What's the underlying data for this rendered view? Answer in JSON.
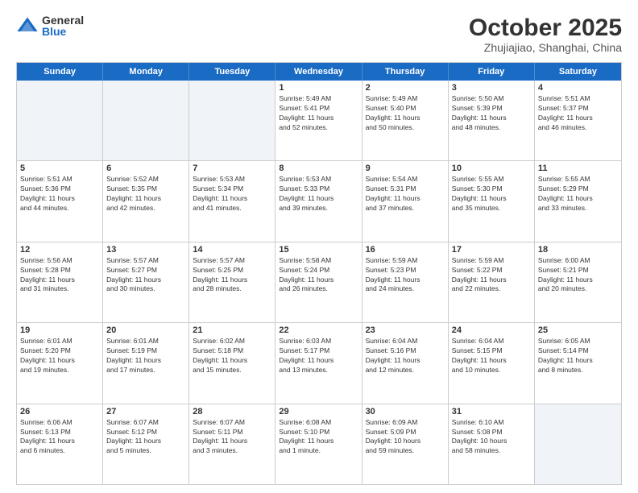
{
  "logo": {
    "general": "General",
    "blue": "Blue"
  },
  "title": "October 2025",
  "location": "Zhujiajiao, Shanghai, China",
  "weekdays": [
    "Sunday",
    "Monday",
    "Tuesday",
    "Wednesday",
    "Thursday",
    "Friday",
    "Saturday"
  ],
  "rows": [
    [
      {
        "day": "",
        "info": ""
      },
      {
        "day": "",
        "info": ""
      },
      {
        "day": "",
        "info": ""
      },
      {
        "day": "1",
        "info": "Sunrise: 5:49 AM\nSunset: 5:41 PM\nDaylight: 11 hours\nand 52 minutes."
      },
      {
        "day": "2",
        "info": "Sunrise: 5:49 AM\nSunset: 5:40 PM\nDaylight: 11 hours\nand 50 minutes."
      },
      {
        "day": "3",
        "info": "Sunrise: 5:50 AM\nSunset: 5:39 PM\nDaylight: 11 hours\nand 48 minutes."
      },
      {
        "day": "4",
        "info": "Sunrise: 5:51 AM\nSunset: 5:37 PM\nDaylight: 11 hours\nand 46 minutes."
      }
    ],
    [
      {
        "day": "5",
        "info": "Sunrise: 5:51 AM\nSunset: 5:36 PM\nDaylight: 11 hours\nand 44 minutes."
      },
      {
        "day": "6",
        "info": "Sunrise: 5:52 AM\nSunset: 5:35 PM\nDaylight: 11 hours\nand 42 minutes."
      },
      {
        "day": "7",
        "info": "Sunrise: 5:53 AM\nSunset: 5:34 PM\nDaylight: 11 hours\nand 41 minutes."
      },
      {
        "day": "8",
        "info": "Sunrise: 5:53 AM\nSunset: 5:33 PM\nDaylight: 11 hours\nand 39 minutes."
      },
      {
        "day": "9",
        "info": "Sunrise: 5:54 AM\nSunset: 5:31 PM\nDaylight: 11 hours\nand 37 minutes."
      },
      {
        "day": "10",
        "info": "Sunrise: 5:55 AM\nSunset: 5:30 PM\nDaylight: 11 hours\nand 35 minutes."
      },
      {
        "day": "11",
        "info": "Sunrise: 5:55 AM\nSunset: 5:29 PM\nDaylight: 11 hours\nand 33 minutes."
      }
    ],
    [
      {
        "day": "12",
        "info": "Sunrise: 5:56 AM\nSunset: 5:28 PM\nDaylight: 11 hours\nand 31 minutes."
      },
      {
        "day": "13",
        "info": "Sunrise: 5:57 AM\nSunset: 5:27 PM\nDaylight: 11 hours\nand 30 minutes."
      },
      {
        "day": "14",
        "info": "Sunrise: 5:57 AM\nSunset: 5:25 PM\nDaylight: 11 hours\nand 28 minutes."
      },
      {
        "day": "15",
        "info": "Sunrise: 5:58 AM\nSunset: 5:24 PM\nDaylight: 11 hours\nand 26 minutes."
      },
      {
        "day": "16",
        "info": "Sunrise: 5:59 AM\nSunset: 5:23 PM\nDaylight: 11 hours\nand 24 minutes."
      },
      {
        "day": "17",
        "info": "Sunrise: 5:59 AM\nSunset: 5:22 PM\nDaylight: 11 hours\nand 22 minutes."
      },
      {
        "day": "18",
        "info": "Sunrise: 6:00 AM\nSunset: 5:21 PM\nDaylight: 11 hours\nand 20 minutes."
      }
    ],
    [
      {
        "day": "19",
        "info": "Sunrise: 6:01 AM\nSunset: 5:20 PM\nDaylight: 11 hours\nand 19 minutes."
      },
      {
        "day": "20",
        "info": "Sunrise: 6:01 AM\nSunset: 5:19 PM\nDaylight: 11 hours\nand 17 minutes."
      },
      {
        "day": "21",
        "info": "Sunrise: 6:02 AM\nSunset: 5:18 PM\nDaylight: 11 hours\nand 15 minutes."
      },
      {
        "day": "22",
        "info": "Sunrise: 6:03 AM\nSunset: 5:17 PM\nDaylight: 11 hours\nand 13 minutes."
      },
      {
        "day": "23",
        "info": "Sunrise: 6:04 AM\nSunset: 5:16 PM\nDaylight: 11 hours\nand 12 minutes."
      },
      {
        "day": "24",
        "info": "Sunrise: 6:04 AM\nSunset: 5:15 PM\nDaylight: 11 hours\nand 10 minutes."
      },
      {
        "day": "25",
        "info": "Sunrise: 6:05 AM\nSunset: 5:14 PM\nDaylight: 11 hours\nand 8 minutes."
      }
    ],
    [
      {
        "day": "26",
        "info": "Sunrise: 6:06 AM\nSunset: 5:13 PM\nDaylight: 11 hours\nand 6 minutes."
      },
      {
        "day": "27",
        "info": "Sunrise: 6:07 AM\nSunset: 5:12 PM\nDaylight: 11 hours\nand 5 minutes."
      },
      {
        "day": "28",
        "info": "Sunrise: 6:07 AM\nSunset: 5:11 PM\nDaylight: 11 hours\nand 3 minutes."
      },
      {
        "day": "29",
        "info": "Sunrise: 6:08 AM\nSunset: 5:10 PM\nDaylight: 11 hours\nand 1 minute."
      },
      {
        "day": "30",
        "info": "Sunrise: 6:09 AM\nSunset: 5:09 PM\nDaylight: 10 hours\nand 59 minutes."
      },
      {
        "day": "31",
        "info": "Sunrise: 6:10 AM\nSunset: 5:08 PM\nDaylight: 10 hours\nand 58 minutes."
      },
      {
        "day": "",
        "info": ""
      }
    ]
  ]
}
